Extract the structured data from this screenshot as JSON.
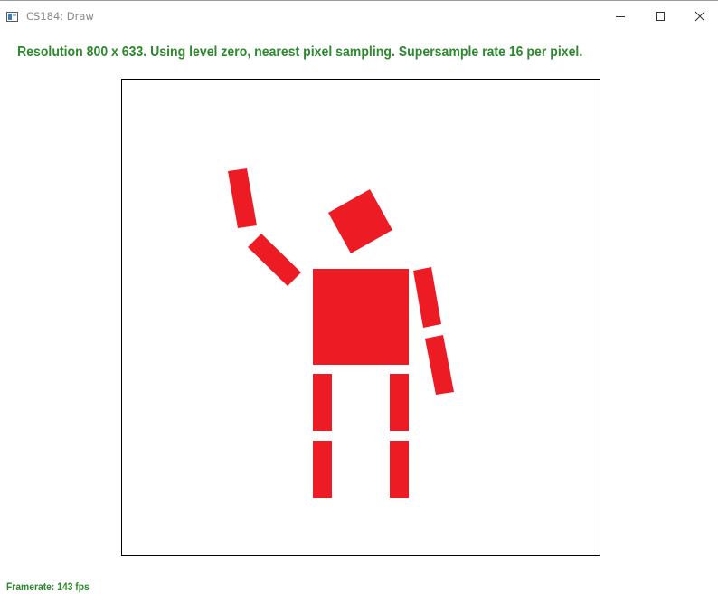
{
  "window": {
    "title": "CS184: Draw",
    "icon": "app-window-icon",
    "controls": [
      "minimize-icon",
      "maximize-icon",
      "close-icon"
    ]
  },
  "status": {
    "text": "Resolution 800 x 633. Using level zero, nearest pixel sampling. Supersample rate 16 per pixel.",
    "color": "#2f8a2f"
  },
  "canvas": {
    "background": "#ffffff",
    "border_color": "#000000",
    "shape_color": "#ed1c24"
  },
  "footer": {
    "framerate": "Framerate: 143 fps"
  }
}
